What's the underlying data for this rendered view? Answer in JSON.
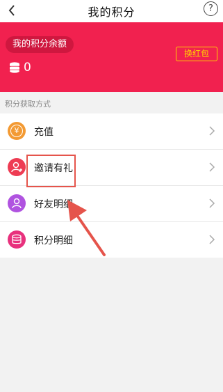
{
  "header": {
    "title": "我的积分",
    "help_glyph": "?"
  },
  "banner": {
    "balance_label": "我的积分余额",
    "points": "0",
    "redeem_button": "换红包",
    "background_color": "#f1214f",
    "accent_color": "#ffd200"
  },
  "section": {
    "title": "积分获取方式"
  },
  "items": [
    {
      "label": "充值",
      "icon": "yuan-icon",
      "color": "#f39a33",
      "glyph": "¥"
    },
    {
      "label": "邀请有礼",
      "icon": "invite-user-icon",
      "color": "#ee3c53"
    },
    {
      "label": "好友明细",
      "icon": "friend-user-icon",
      "color": "#b053e0"
    },
    {
      "label": "积分明细",
      "icon": "points-stack-icon",
      "color": "#e8317d"
    }
  ],
  "annotation": {
    "color": "#e5544b"
  }
}
